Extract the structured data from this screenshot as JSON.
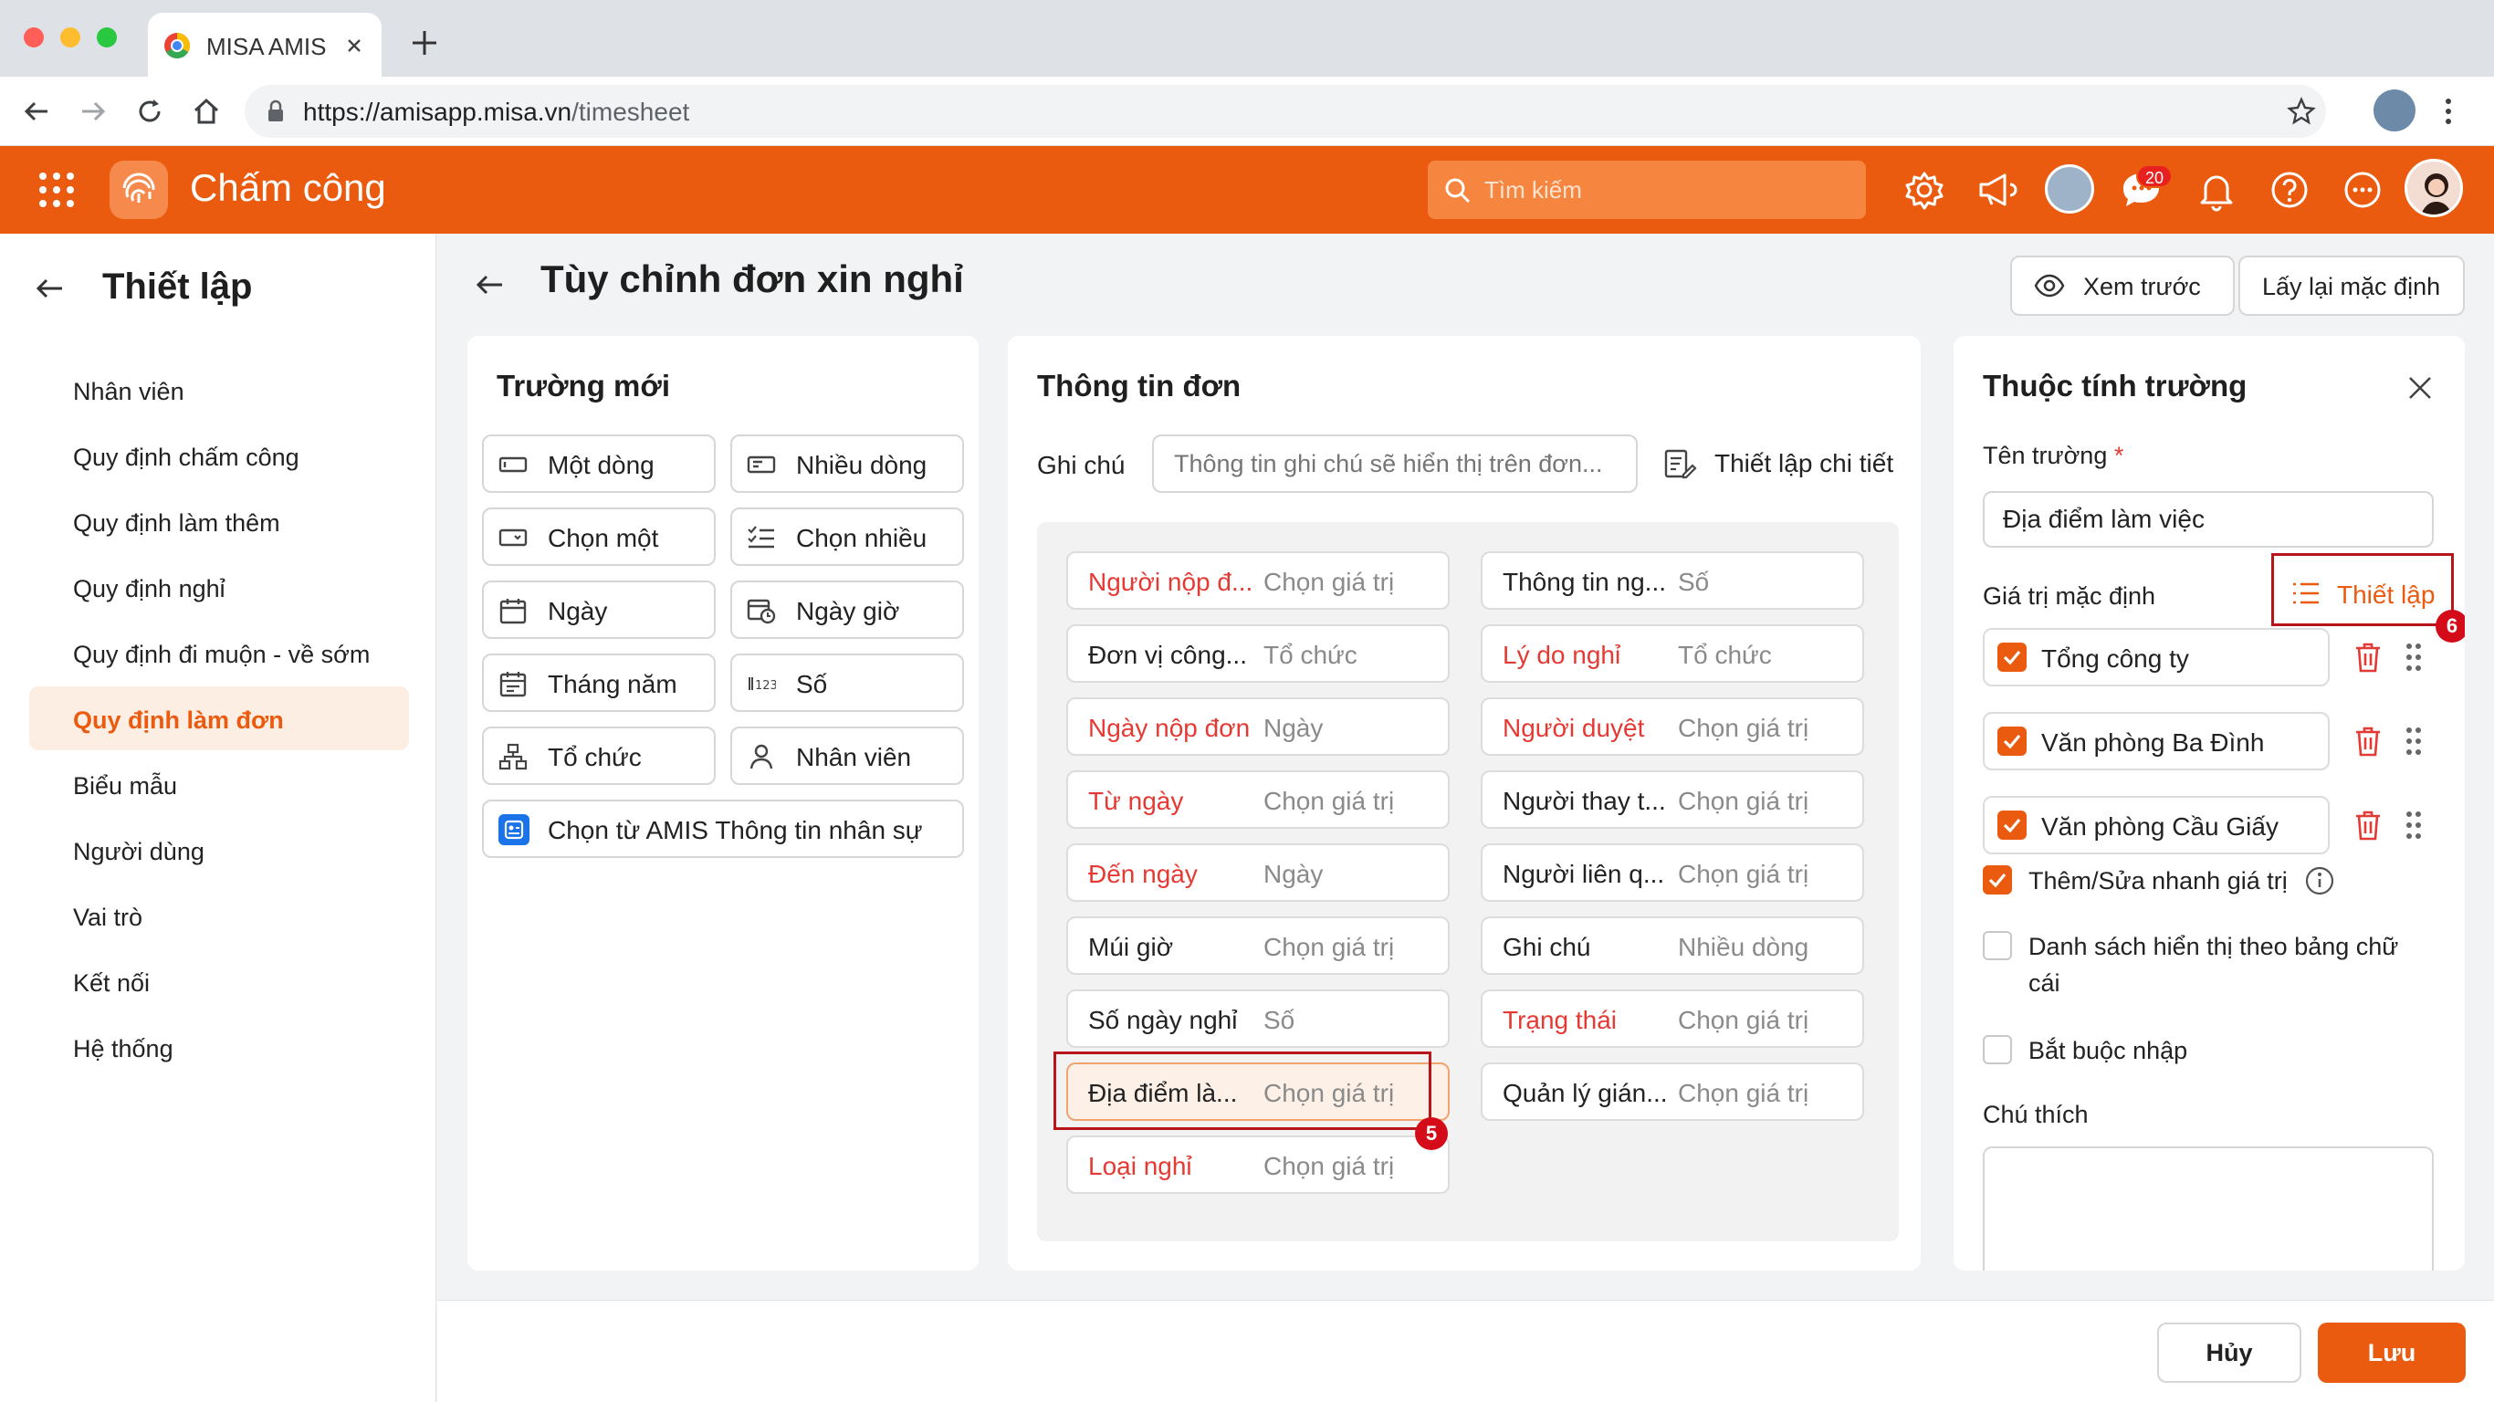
{
  "browser": {
    "tab_title": "MISA AMIS",
    "url_host": "https://amisapp.misa.vn",
    "url_path": "/timesheet"
  },
  "app": {
    "title": "Chấm công",
    "search_placeholder": "Tìm kiếm",
    "notification_count": "20",
    "accent": "#eb5b0f"
  },
  "sidebar": {
    "title": "Thiết lập",
    "items": [
      "Nhân viên",
      "Quy định chấm công",
      "Quy định làm thêm",
      "Quy định nghỉ",
      "Quy định đi muộn - về sớm",
      "Quy định làm đơn",
      "Biểu mẫu",
      "Người dùng",
      "Vai trò",
      "Kết nối",
      "Hệ thống"
    ],
    "active_index": 5
  },
  "page": {
    "title": "Tùy chỉnh đơn xin nghỉ",
    "preview_label": "Xem trước",
    "reset_label": "Lấy lại mặc định"
  },
  "new_fields": {
    "title": "Trường mới",
    "items": [
      {
        "label": "Một dòng",
        "icon": "single-line-icon"
      },
      {
        "label": "Nhiều dòng",
        "icon": "multi-line-icon"
      },
      {
        "label": "Chọn một",
        "icon": "dropdown-icon"
      },
      {
        "label": "Chọn nhiều",
        "icon": "checklist-icon"
      },
      {
        "label": "Ngày",
        "icon": "calendar-icon"
      },
      {
        "label": "Ngày giờ",
        "icon": "datetime-icon"
      },
      {
        "label": "Tháng năm",
        "icon": "month-icon"
      },
      {
        "label": "Số",
        "icon": "number-icon"
      },
      {
        "label": "Tổ chức",
        "icon": "org-icon"
      },
      {
        "label": "Nhân viên",
        "icon": "person-icon"
      }
    ],
    "amis_label": "Chọn từ AMIS Thông tin nhân sự"
  },
  "form_info": {
    "title": "Thông tin đơn",
    "note_label": "Ghi chú",
    "note_placeholder": "Thông tin ghi chú sẽ hiển thị trên đơn...",
    "detail_label": "Thiết lập chi tiết",
    "left": [
      {
        "name": "Người nộp đ...",
        "type": "Chọn giá trị",
        "required": true
      },
      {
        "name": "Đơn vị công...",
        "type": "Tổ chức",
        "required": false
      },
      {
        "name": "Ngày nộp đơn",
        "type": "Ngày",
        "required": true
      },
      {
        "name": "Từ ngày",
        "type": "Chọn giá trị",
        "required": true
      },
      {
        "name": "Đến ngày",
        "type": "Ngày",
        "required": true
      },
      {
        "name": "Múi giờ",
        "type": "Chọn giá trị",
        "required": false
      },
      {
        "name": "Số ngày nghỉ",
        "type": "Số",
        "required": false
      },
      {
        "name": "Địa điểm là...",
        "type": "Chọn giá trị",
        "required": false,
        "selected": true
      },
      {
        "name": "Loại nghỉ",
        "type": "Chọn giá trị",
        "required": true
      }
    ],
    "right": [
      {
        "name": "Thông tin ng...",
        "type": "Số",
        "required": false
      },
      {
        "name": "Lý do nghỉ",
        "type": "Tổ chức",
        "required": true
      },
      {
        "name": "Người duyệt",
        "type": "Chọn giá trị",
        "required": true
      },
      {
        "name": "Người thay t...",
        "type": "Chọn giá trị",
        "required": false
      },
      {
        "name": "Người liên q...",
        "type": "Chọn giá trị",
        "required": false
      },
      {
        "name": "Ghi chú",
        "type": "Nhiều dòng",
        "required": false
      },
      {
        "name": "Trạng thái",
        "type": "Chọn giá trị",
        "required": true
      },
      {
        "name": "Quản lý gián...",
        "type": "Chọn giá trị",
        "required": false
      }
    ],
    "callout": "5"
  },
  "props": {
    "title": "Thuộc tính trường",
    "name_label": "Tên trường",
    "required_mark": "*",
    "name_value": "Địa điểm làm việc",
    "default_label": "Giá trị mặc định",
    "setup_label": "Thiết lập",
    "callout": "6",
    "values": [
      "Tổng công ty",
      "Văn phòng Ba Đình",
      "Văn phòng Cầu Giấy"
    ],
    "quick_edit_label": "Thêm/Sửa nhanh giá trị",
    "alpha_label_1": "Danh sách hiển thị theo bảng chữ",
    "alpha_label_2": "cái",
    "required_label": "Bắt buộc nhập",
    "note_label": "Chú thích"
  },
  "footer": {
    "cancel_label": "Hủy",
    "save_label": "Lưu"
  }
}
